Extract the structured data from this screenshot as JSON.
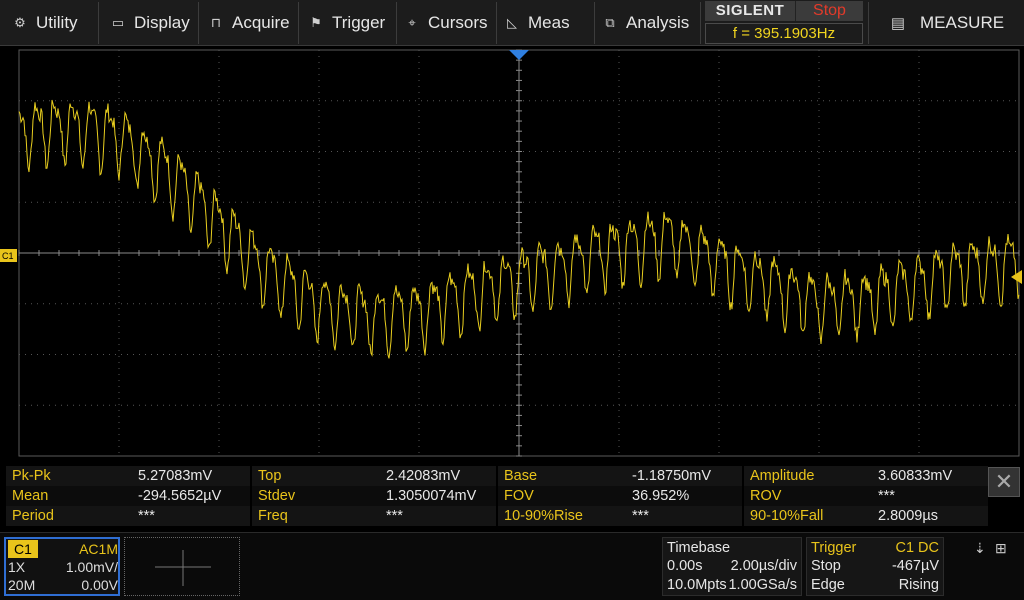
{
  "menu": {
    "items": [
      {
        "label": "Utility",
        "icon": "gear-icon"
      },
      {
        "label": "Display",
        "icon": "monitor-icon"
      },
      {
        "label": "Acquire",
        "icon": "acquire-wave-icon"
      },
      {
        "label": "Trigger",
        "icon": "flag-icon"
      },
      {
        "label": "Cursors",
        "icon": "crosshair-icon"
      },
      {
        "label": "Meas",
        "icon": "meas-ramp-icon"
      },
      {
        "label": "Analysis",
        "icon": "analysis-icon"
      }
    ],
    "brand": "SIGLENT",
    "run_state": "Stop",
    "frequency": "f = 395.1903Hz",
    "measure_label": "MEASURE"
  },
  "channel_marker": "C1",
  "measurements": [
    [
      {
        "label": "Pk-Pk",
        "value": "5.27083mV"
      },
      {
        "label": "Top",
        "value": "2.42083mV"
      },
      {
        "label": "Base",
        "value": "-1.18750mV"
      },
      {
        "label": "Amplitude",
        "value": "3.60833mV"
      }
    ],
    [
      {
        "label": "Mean",
        "value": "-294.5652µV"
      },
      {
        "label": "Stdev",
        "value": "1.3050074mV"
      },
      {
        "label": "FOV",
        "value": "36.952%"
      },
      {
        "label": "ROV",
        "value": "***"
      }
    ],
    [
      {
        "label": "Period",
        "value": "***"
      },
      {
        "label": "Freq",
        "value": "***"
      },
      {
        "label": "10-90%Rise",
        "value": "***"
      },
      {
        "label": "90-10%Fall",
        "value": "2.8009µs"
      }
    ]
  ],
  "channel": {
    "name": "C1",
    "coupling": "AC1M",
    "probe": "1X",
    "scale": "1.00mV/",
    "bandwidth": "20M",
    "offset": "0.00V"
  },
  "timebase": {
    "title": "Timebase",
    "delay": "0.00s",
    "scale": "2.00µs/div",
    "memory": "10.0Mpts",
    "sample_rate": "1.00GSa/s"
  },
  "trigger": {
    "title": "Trigger",
    "source": "C1 DC",
    "state": "Stop",
    "level": "-467µV",
    "type": "Edge",
    "slope": "Rising"
  },
  "colors": {
    "trace": "#e9cf1f",
    "label": "#e9c41b",
    "stop": "#e23a2a",
    "channel_border": "#2f6ed3"
  },
  "waveform": {
    "volts_per_div": 1.0,
    "time_per_div_us": 2.0,
    "offset_mv": 0.0,
    "envelope_mv": [
      [
        -10,
        2.4
      ],
      [
        -9,
        2.5
      ],
      [
        -8,
        2.3
      ],
      [
        -7,
        1.6
      ],
      [
        -6,
        0.6
      ],
      [
        -5,
        -0.4
      ],
      [
        -4,
        -1.0
      ],
      [
        -3,
        -1.25
      ],
      [
        -2,
        -1.15
      ],
      [
        -1,
        -0.8
      ],
      [
        0,
        -0.5
      ],
      [
        1,
        -0.2
      ],
      [
        2,
        0.1
      ],
      [
        3,
        0.3
      ],
      [
        4,
        -0.2
      ],
      [
        5,
        -0.6
      ],
      [
        6,
        -1.0
      ],
      [
        7,
        -0.9
      ],
      [
        8,
        -0.6
      ],
      [
        9,
        -0.3
      ],
      [
        10,
        -0.2
      ]
    ],
    "ripple_mv": 0.55,
    "ripple_period_us": 0.36
  }
}
